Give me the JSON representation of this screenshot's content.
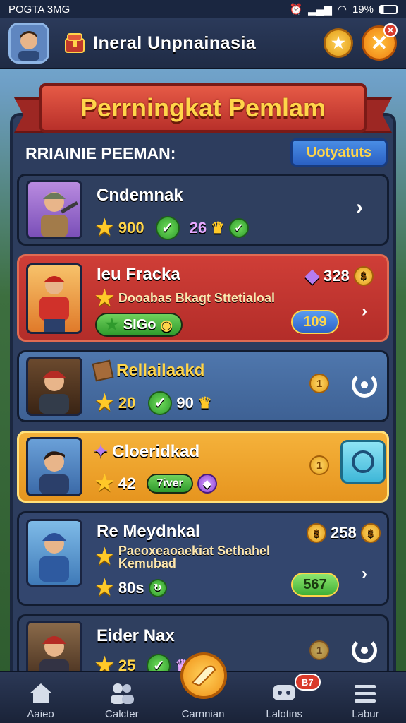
{
  "status_bar": {
    "left": "POGTA 3MG",
    "battery": "19%"
  },
  "header": {
    "title": "Ineral Unpnainasia"
  },
  "banner": {
    "title": "Perrningkat Pemlam"
  },
  "section": {
    "label": "RRIAINIE PEEMAN:",
    "update_button": "Uotyatuts"
  },
  "players": [
    {
      "name": "Cndemnak",
      "stars": "900",
      "level": "26"
    },
    {
      "name": "Ieu Fracka",
      "desc": "Dooabas Bkagt Sttetialoal",
      "gems": "328",
      "badge": "SIGo",
      "score": "109"
    },
    {
      "name": "Rellailaakd",
      "stars": "20",
      "level": "90"
    },
    {
      "name": "Cloeridkad",
      "stars": "42",
      "badge": "7iver"
    },
    {
      "name": "Re Meydnkal",
      "desc": "Paeoxeaoaekiat Sethahel Kemubad",
      "gems": "258",
      "stars": "80s",
      "score": "567"
    },
    {
      "name": "Eider Nax",
      "stars": "25"
    }
  ],
  "bottom_nav": [
    {
      "label": "Aaieo",
      "icon": "home-icon"
    },
    {
      "label": "Calcter",
      "icon": "friends-icon"
    },
    {
      "label": "Carnnian",
      "icon": "battle-icon"
    },
    {
      "label": "Lalotins",
      "icon": "chat-icon",
      "badge": "B7"
    },
    {
      "label": "Labur",
      "icon": "menu-icon"
    }
  ],
  "colors": {
    "accent": "#ffd54a",
    "red_card": "#cf3e37",
    "gold_card": "#f5b23b",
    "blue_card": "#4f77ad"
  }
}
